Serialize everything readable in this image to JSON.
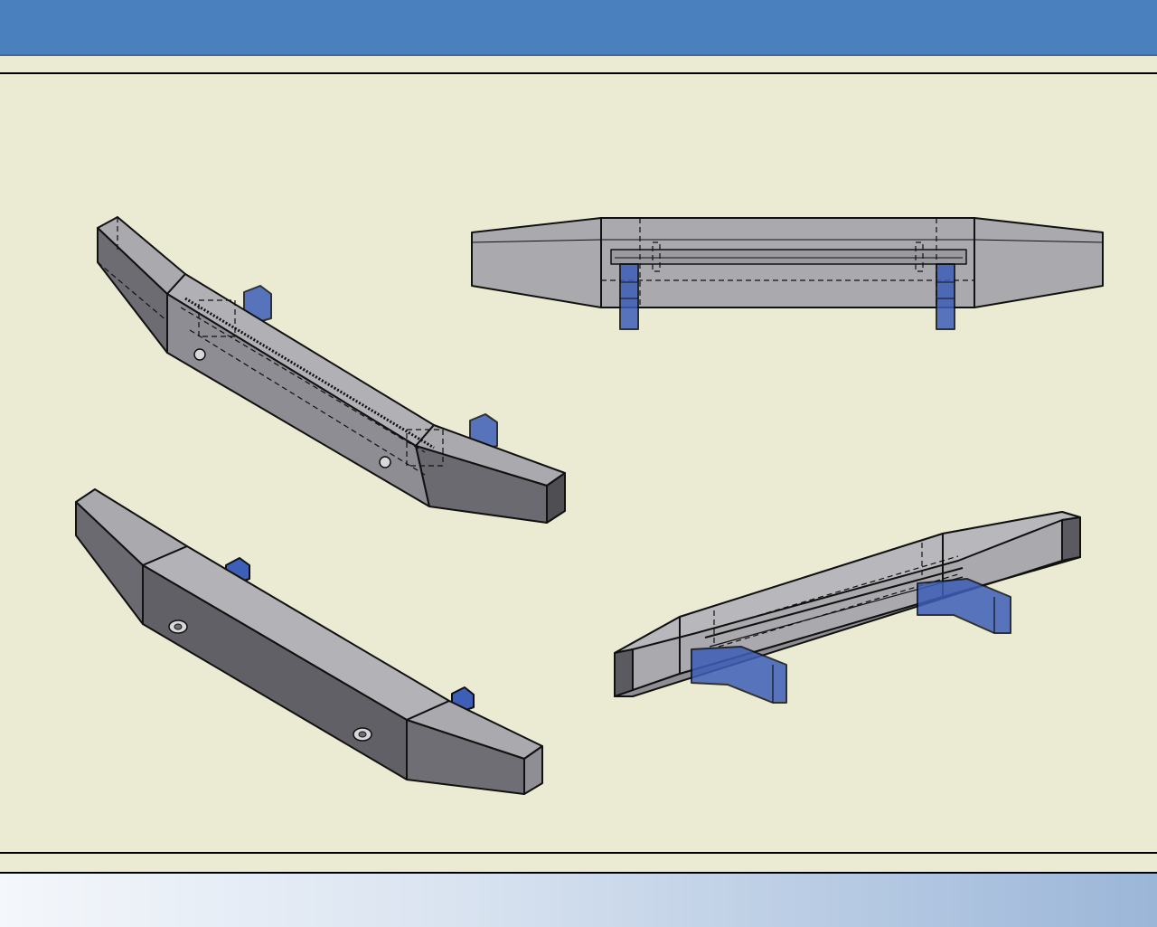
{
  "views": [
    {
      "id": "iso-hidden",
      "label": ""
    },
    {
      "id": "top",
      "label": ""
    },
    {
      "id": "iso-shaded",
      "label": ""
    },
    {
      "id": "iso-rear",
      "label": ""
    }
  ],
  "colors": {
    "title_bar": "#4a80be",
    "sheet": "#ebebd3",
    "face_light": "#a9a9ae",
    "face_mid": "#8a8a90",
    "face_dark": "#5e5e63",
    "bracket_blue": "#3d5fb8",
    "edge": "#111111"
  }
}
